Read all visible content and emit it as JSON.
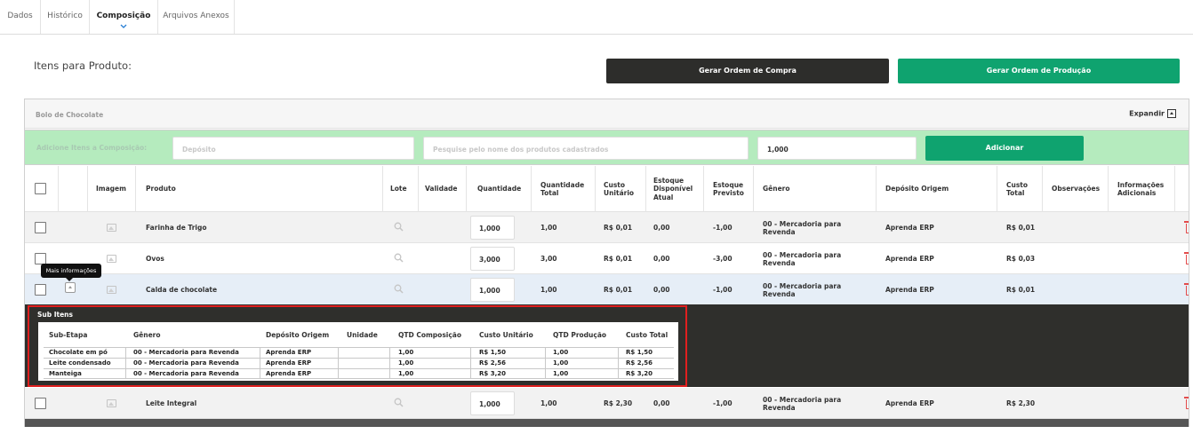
{
  "tabs": [
    "Dados",
    "Histórico",
    "Composição",
    "Arquivos Anexos"
  ],
  "section_title": "Itens para Produto:",
  "buttons": {
    "purchase_order": "Gerar Ordem de Compra",
    "production_order": "Gerar Ordem de Produção",
    "add": "Adicionar",
    "expand": "Expandir"
  },
  "panel_title": "Bolo de Chocolate",
  "add_bar": {
    "label": "Adicione Itens a Composição:",
    "deposit_placeholder": "Depósito",
    "search_placeholder": "Pesquise pelo nome dos produtos cadastrados",
    "quantity_value": "1,000"
  },
  "columns": {
    "image": "Imagem",
    "product": "Produto",
    "lot": "Lote",
    "validity": "Validade",
    "quantity": "Quantidade",
    "total_quantity": "Quantidade Total",
    "unit_cost": "Custo Unitário",
    "stock_available": "Estoque Disponível Atual",
    "stock_forecast": "Estoque Previsto",
    "genre": "Gênero",
    "origin_deposit": "Depósito Origem",
    "total_cost": "Custo Total",
    "notes": "Observações",
    "additional_info": "Informações Adicionais"
  },
  "rows": [
    {
      "product": "Farinha de Trigo",
      "quantity": "1,000",
      "total_quantity": "1,00",
      "unit_cost": "R$ 0,01",
      "stock_available": "0,00",
      "stock_forecast": "-1,00",
      "genre": "00 - Mercadoria para Revenda",
      "origin_deposit": "Aprenda ERP",
      "total_cost": "R$ 0,01"
    },
    {
      "product": "Ovos",
      "quantity": "3,000",
      "total_quantity": "3,00",
      "unit_cost": "R$ 0,01",
      "stock_available": "0,00",
      "stock_forecast": "-3,00",
      "genre": "00 - Mercadoria para Revenda",
      "origin_deposit": "Aprenda ERP",
      "total_cost": "R$ 0,03"
    },
    {
      "product": "Calda de chocolate",
      "quantity": "1,000",
      "total_quantity": "1,00",
      "unit_cost": "R$ 0,01",
      "stock_available": "0,00",
      "stock_forecast": "-1,00",
      "genre": "00 - Mercadoria para Revenda",
      "origin_deposit": "Aprenda ERP",
      "total_cost": "R$ 0,01"
    },
    {
      "product": "Leite Integral",
      "quantity": "1,000",
      "total_quantity": "1,00",
      "unit_cost": "R$ 2,30",
      "stock_available": "0,00",
      "stock_forecast": "-1,00",
      "genre": "00 - Mercadoria para Revenda",
      "origin_deposit": "Aprenda ERP",
      "total_cost": "R$ 2,30"
    }
  ],
  "tooltip": "Mais informações",
  "sub_items": {
    "title": "Sub Itens",
    "columns": [
      "Sub-Etapa",
      "Gênero",
      "Depósito Origem",
      "Unidade",
      "QTD Composição",
      "Custo Unitário",
      "QTD Produção",
      "Custo Total"
    ],
    "rows": [
      {
        "step": "Chocolate em pó",
        "genre": "00 - Mercadoria para Revenda",
        "deposit": "Aprenda ERP",
        "unit": "",
        "qty_comp": "1,00",
        "unit_cost": "R$ 1,50",
        "qty_prod": "1,00",
        "total_cost": "R$ 1,50"
      },
      {
        "step": "Leite condensado",
        "genre": "00 - Mercadoria para Revenda",
        "deposit": "Aprenda ERP",
        "unit": "",
        "qty_comp": "1,00",
        "unit_cost": "R$ 2,56",
        "qty_prod": "1,00",
        "total_cost": "R$ 2,56"
      },
      {
        "step": "Manteiga",
        "genre": "00 - Mercadoria para Revenda",
        "deposit": "Aprenda ERP",
        "unit": "",
        "qty_comp": "1,00",
        "unit_cost": "R$ 3,20",
        "qty_prod": "1,00",
        "total_cost": "R$ 3,20"
      }
    ]
  },
  "colors": {
    "accent_green": "#0fa36f",
    "dark_button": "#2d2d2b",
    "add_bar_bg": "#b5ebbe",
    "highlight_red": "#e01f1f",
    "trash_red": "#e34b4b"
  }
}
